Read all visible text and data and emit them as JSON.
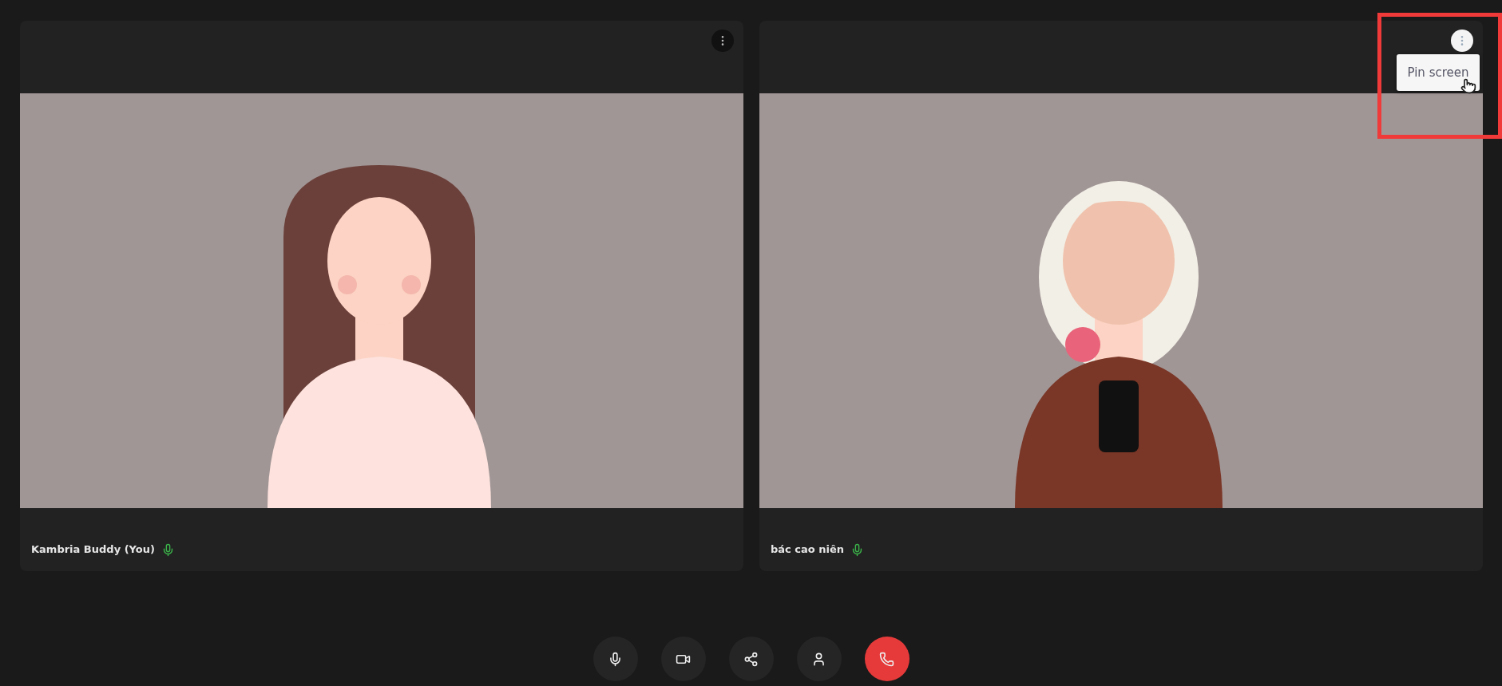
{
  "tiles": [
    {
      "name": "Kambria Buddy (You)",
      "mic_on": true,
      "menu_open": false,
      "picture": {
        "kind": "picture"
      }
    },
    {
      "name": "bác cao niên",
      "mic_on": true,
      "menu_open": true,
      "menu_items": [
        "Pin screen"
      ],
      "picture": {
        "kind": "picture"
      }
    }
  ],
  "controls": [
    {
      "kind": "mic"
    },
    {
      "kind": "camera"
    },
    {
      "kind": "share"
    },
    {
      "kind": "person"
    },
    {
      "kind": "end"
    }
  ]
}
